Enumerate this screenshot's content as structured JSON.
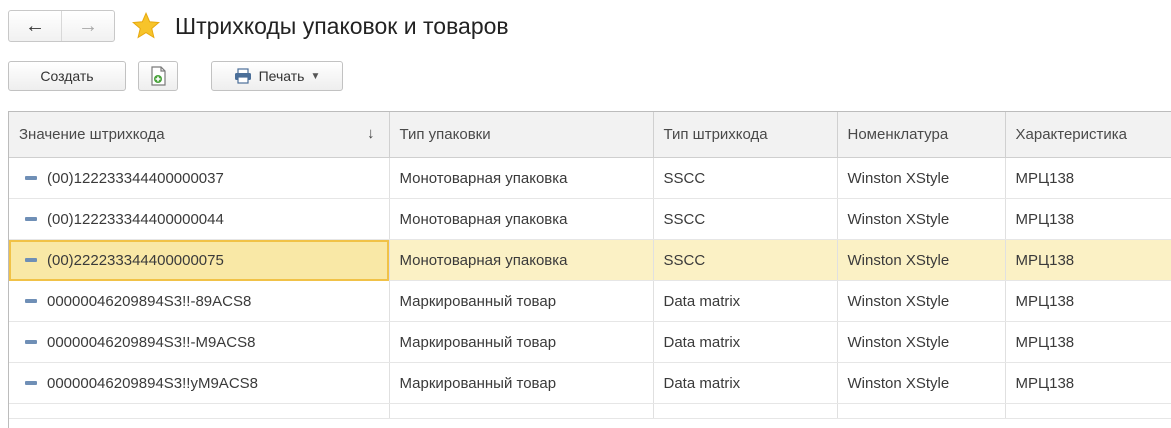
{
  "window": {
    "title": "Штрихкоды упаковок и товаров",
    "back_glyph": "←",
    "forward_glyph": "→",
    "favorite_icon": "star-icon"
  },
  "toolbar": {
    "create_label": "Создать",
    "copy_icon": "copy-document-icon",
    "print_label": "Печать",
    "print_icon": "printer-icon",
    "dropdown_glyph": "▼"
  },
  "table": {
    "columns": [
      {
        "label": "Значение штрихкода",
        "sort": "↓"
      },
      {
        "label": "Тип упаковки"
      },
      {
        "label": "Тип штрихкода"
      },
      {
        "label": "Номенклатура"
      },
      {
        "label": "Характеристика"
      }
    ],
    "rows": [
      {
        "barcode": "(00)122233344400000037",
        "pack_type": "Монотоварная упаковка",
        "barcode_type": "SSCC",
        "item": "Winston XStyle",
        "characteristic": "МРЦ138"
      },
      {
        "barcode": "(00)122233344400000044",
        "pack_type": "Монотоварная упаковка",
        "barcode_type": "SSCC",
        "item": "Winston XStyle",
        "characteristic": "МРЦ138"
      },
      {
        "barcode": "(00)222233344400000075",
        "pack_type": "Монотоварная упаковка",
        "barcode_type": "SSCC",
        "item": "Winston XStyle",
        "characteristic": "МРЦ138"
      },
      {
        "barcode": "00000046209894S3!!-89ACS8",
        "pack_type": "Маркированный товар",
        "barcode_type": "Data matrix",
        "item": "Winston XStyle",
        "characteristic": "МРЦ138"
      },
      {
        "barcode": "00000046209894S3!!-M9ACS8",
        "pack_type": "Маркированный товар",
        "barcode_type": "Data matrix",
        "item": "Winston XStyle",
        "characteristic": "МРЦ138"
      },
      {
        "barcode": "00000046209894S3!!yM9ACS8",
        "pack_type": "Маркированный товар",
        "barcode_type": "Data matrix",
        "item": "Winston XStyle",
        "characteristic": "МРЦ138"
      }
    ],
    "selected_row": 2,
    "colors": {
      "selected_row": "#fbf1c5",
      "selected_cell_border": "#f1c247",
      "row_icon": "#6f8fb6",
      "header_bg": "#f2f2f2"
    }
  }
}
